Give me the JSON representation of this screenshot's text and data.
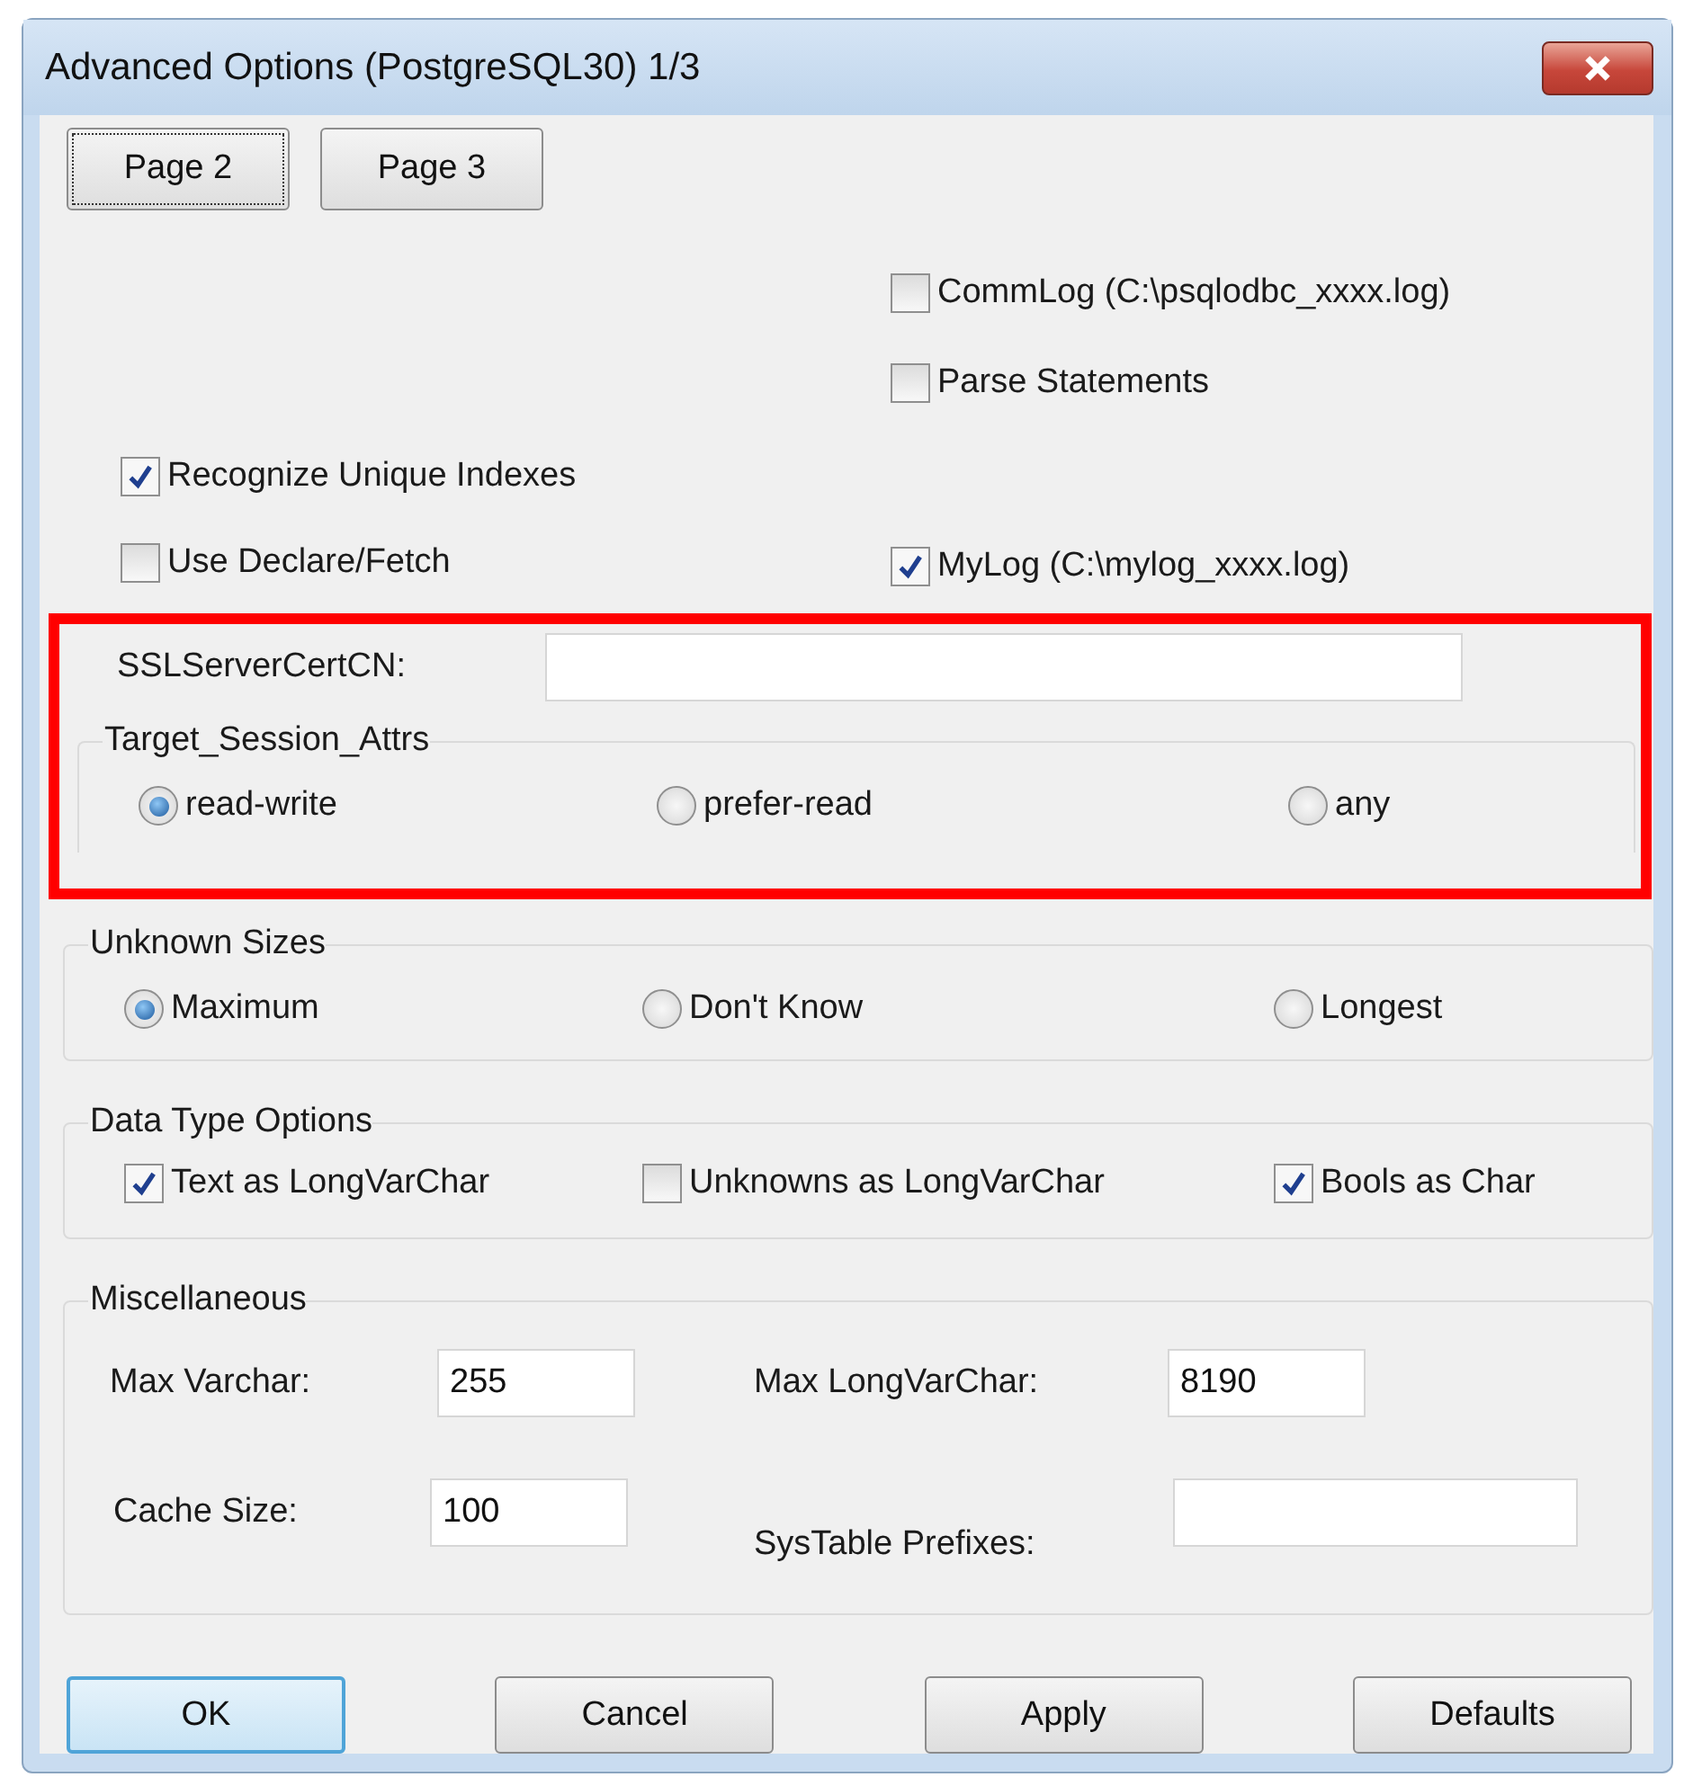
{
  "window": {
    "title": "Advanced Options (PostgreSQL30) 1/3"
  },
  "page_buttons": [
    {
      "label": "Page 2",
      "focused": true
    },
    {
      "label": "Page 3",
      "focused": false
    }
  ],
  "option_rows": [
    {
      "right": {
        "label": "CommLog (C:\\psqlodbc_xxxx.log)",
        "checked": false
      }
    },
    {
      "right": {
        "label": "Parse Statements",
        "checked": false
      }
    },
    {
      "left": {
        "label": "Recognize Unique Indexes",
        "checked": true
      }
    },
    {
      "left": {
        "label": "Use Declare/Fetch",
        "checked": false
      },
      "right": {
        "label": "MyLog (C:\\mylog_xxxx.log)",
        "checked": true
      }
    }
  ],
  "ssl_server_cert_cn": {
    "label": "SSLServerCertCN:"
  },
  "target_session_attrs": {
    "title": "Target_Session_Attrs",
    "options": [
      {
        "label": "read-write",
        "selected": true
      },
      {
        "label": "prefer-read",
        "selected": false
      },
      {
        "label": "any",
        "selected": false
      }
    ]
  },
  "unknown_sizes": {
    "title": "Unknown Sizes",
    "options": [
      {
        "label": "Maximum",
        "selected": true
      },
      {
        "label": "Don't Know",
        "selected": false
      },
      {
        "label": "Longest",
        "selected": false
      }
    ]
  },
  "data_type_options": {
    "title": "Data Type Options",
    "options": [
      {
        "label": "Text as LongVarChar",
        "checked": true
      },
      {
        "label": "Unknowns as LongVarChar",
        "checked": false
      },
      {
        "label": "Bools as Char",
        "checked": true
      }
    ]
  },
  "miscellaneous": {
    "title": "Miscellaneous",
    "fields": [
      {
        "label": "Max Varchar:",
        "value": "255"
      },
      {
        "label": "Max LongVarChar:",
        "value": "8190"
      },
      {
        "label": "Cache Size:",
        "value": "100"
      },
      {
        "label": "SysTable Prefixes:"
      }
    ]
  },
  "buttons": [
    {
      "label": "OK",
      "default": true
    },
    {
      "label": "Cancel",
      "default": false
    },
    {
      "label": "Apply",
      "default": false
    },
    {
      "label": "Defaults",
      "default": false
    }
  ]
}
